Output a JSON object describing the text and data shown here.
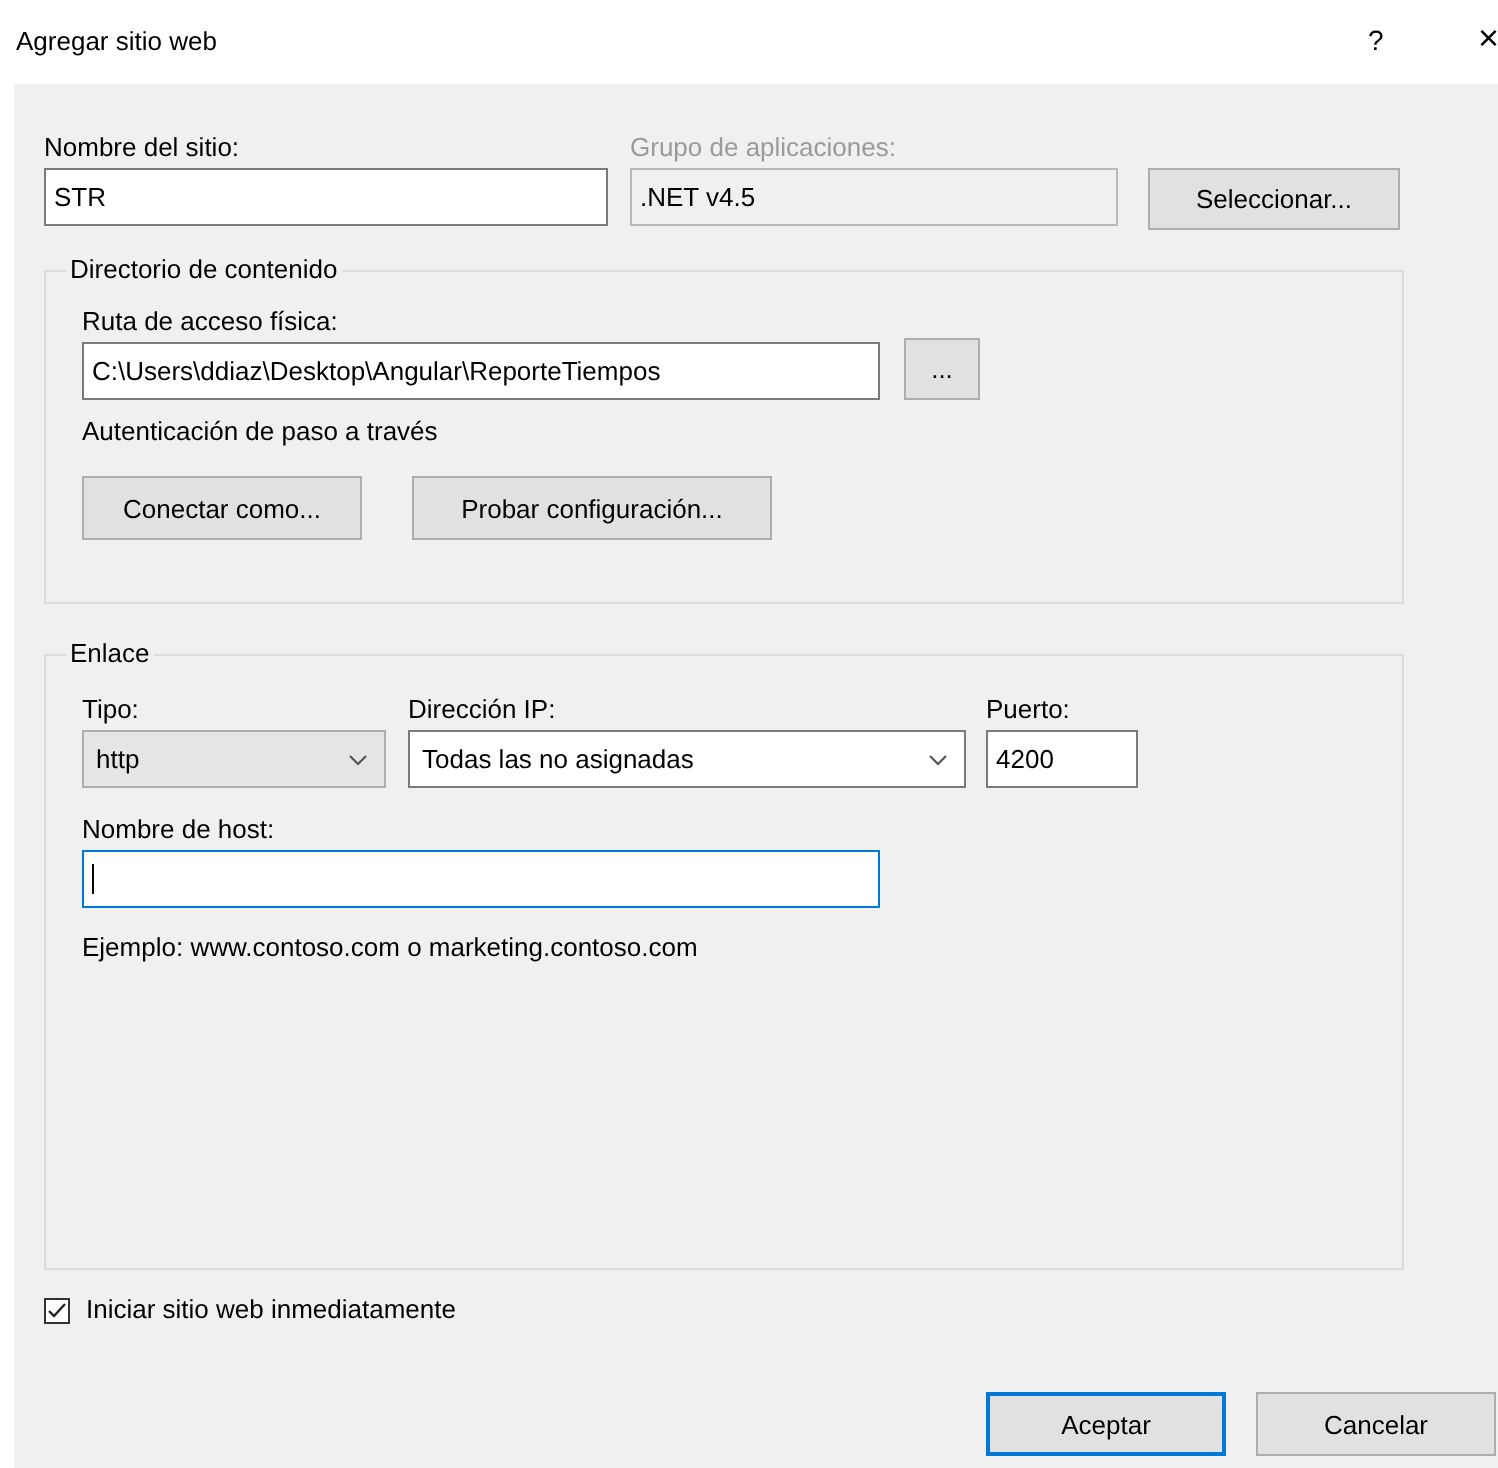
{
  "window": {
    "title": "Agregar sitio web",
    "help": "?",
    "close": "×"
  },
  "site_name": {
    "label": "Nombre del sitio:",
    "value": "STR"
  },
  "app_pool": {
    "label": "Grupo de aplicaciones:",
    "value": ".NET v4.5",
    "disabled": true,
    "button": "Seleccionar..."
  },
  "content_directory": {
    "legend": "Directorio de contenido",
    "path_label": "Ruta de acceso física:",
    "path_value": "C:\\Users\\ddiaz\\Desktop\\Angular\\ReporteTiempos",
    "browse_button": "...",
    "auth_text": "Autenticación de paso a través",
    "buttons": [
      "Conectar como...",
      "Probar configuración..."
    ]
  },
  "binding": {
    "legend": "Enlace",
    "type": {
      "label": "Tipo:",
      "value": "http"
    },
    "ip": {
      "label": "Dirección IP:",
      "value": "Todas las no asignadas"
    },
    "port": {
      "label": "Puerto:",
      "value": "4200"
    },
    "host": {
      "label": "Nombre de host:",
      "focused": true
    },
    "example": "Ejemplo: www.contoso.com o marketing.contoso.com"
  },
  "start_now": {
    "label": "Iniciar sitio web inmediatamente",
    "checked": true
  },
  "buttons": [
    {
      "label": "Aceptar",
      "default": true
    },
    {
      "label": "Cancelar",
      "default": false
    }
  ]
}
